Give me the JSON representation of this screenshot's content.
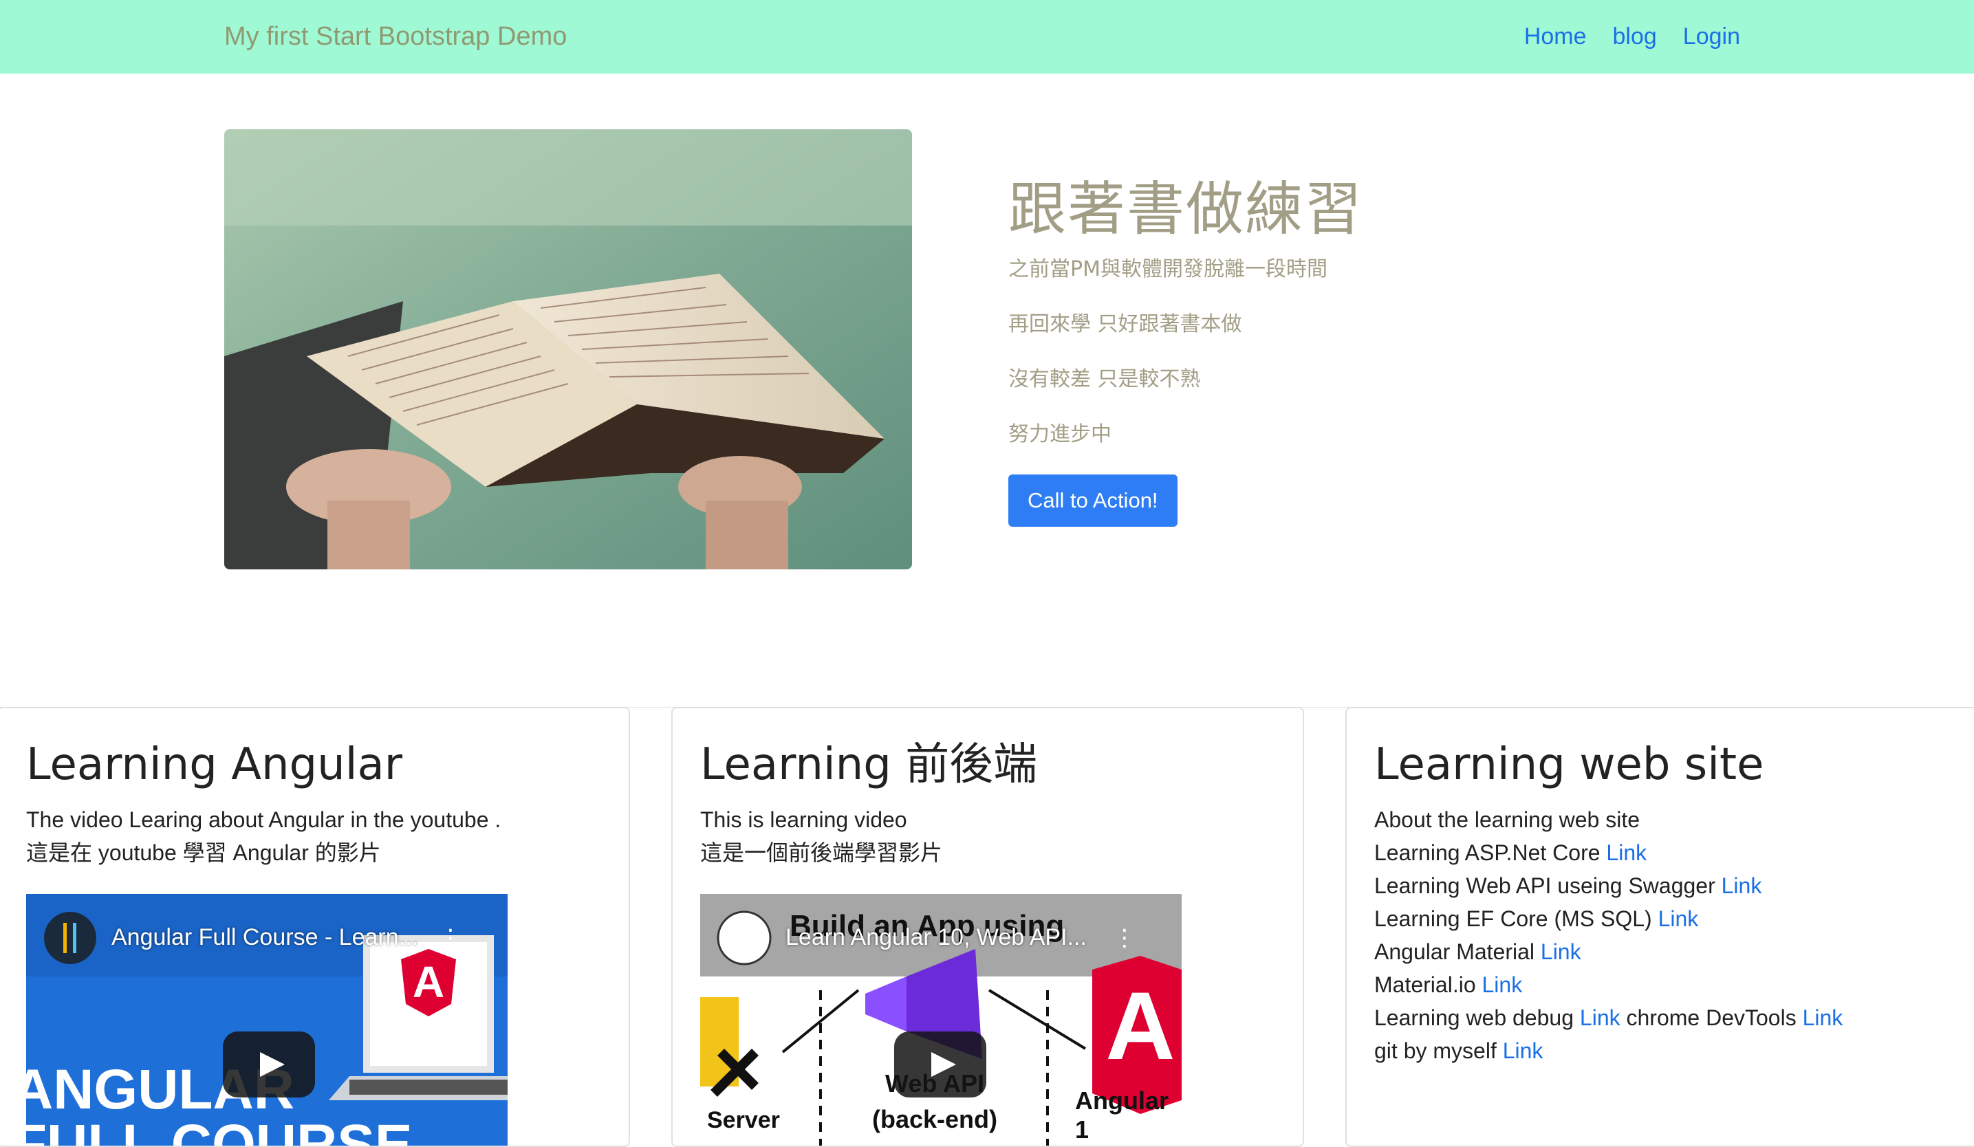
{
  "navbar": {
    "brand": "My first Start Bootstrap Demo",
    "links": [
      "Home",
      "blog",
      "Login"
    ],
    "background": "#a0f9d5"
  },
  "hero": {
    "image_icon": "book-reading-image",
    "title": "跟著書做練習",
    "lines": [
      "之前當PM與軟體開發脫離一段時間",
      "再回來學 只好跟著書本做",
      "沒有較差 只是較不熟",
      "努力進步中"
    ],
    "cta_label": "Call to Action!",
    "cta_color": "#2f7df4"
  },
  "cards": [
    {
      "title": "Learning Angular",
      "text": [
        "The video Learing about Angular in the youtube .",
        "這是在 youtube 學習 Angular 的影片"
      ],
      "video": {
        "title": "Angular Full Course - Learn...",
        "menu": "⋮",
        "overlay": [
          "ANGULAR",
          "FULL COURSE"
        ]
      }
    },
    {
      "title": "Learning 前後端",
      "text": [
        "This is learning video",
        "這是一個前後端學習影片"
      ],
      "video": {
        "title": "Learn Angular 10, Web API...",
        "menu": "⋮",
        "heading": "Build an App using",
        "labels": [
          "Server",
          "Web API",
          "(back-end)",
          "Angular 1"
        ]
      }
    },
    {
      "title": "Learning web site",
      "intro": "About the learning web site",
      "items": [
        {
          "text": "Learning ASP.Net Core ",
          "link": "Link"
        },
        {
          "text": "Learning Web API useing Swagger ",
          "link": "Link"
        },
        {
          "text": "Learning EF Core (MS SQL) ",
          "link": "Link"
        },
        {
          "text": "Angular Material ",
          "link": "Link"
        },
        {
          "text": "Material.io ",
          "link": "Link"
        },
        {
          "text": "Learning web debug ",
          "link": "Link",
          "text2": " chrome DevTools ",
          "link2": "Link"
        },
        {
          "text": "git by myself ",
          "link": "Link"
        }
      ]
    }
  ]
}
